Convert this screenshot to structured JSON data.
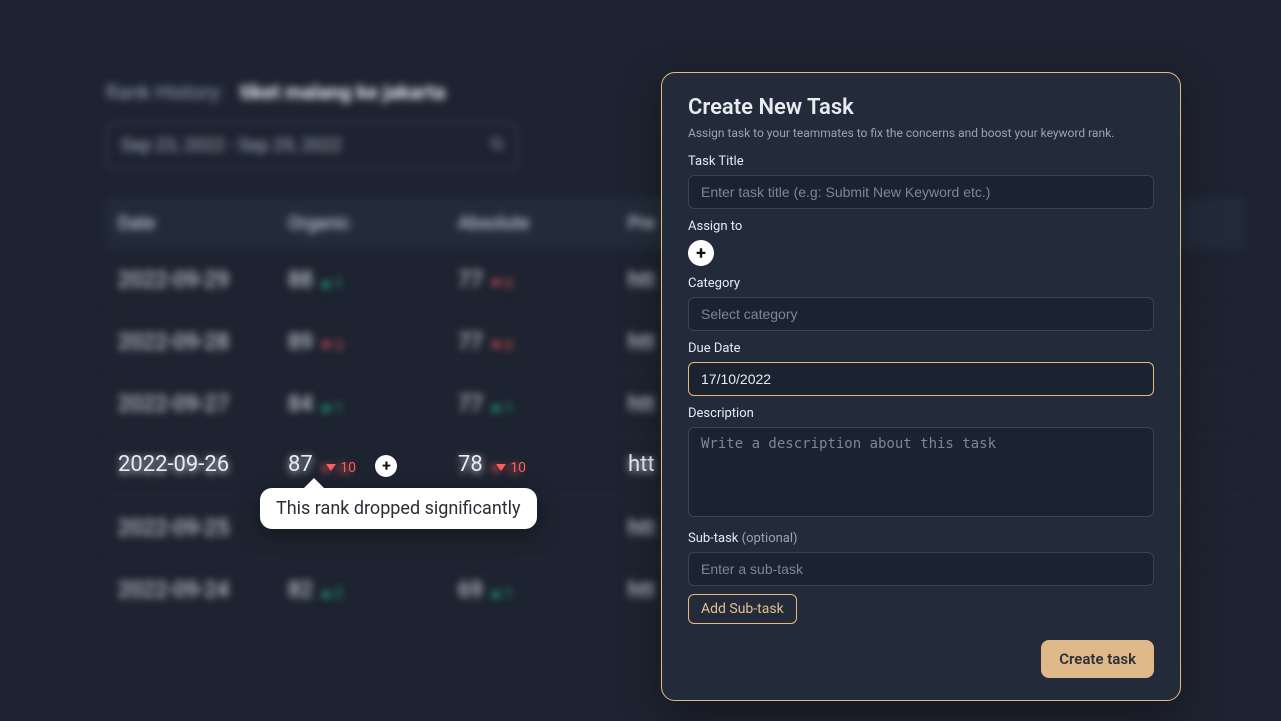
{
  "page": {
    "header_label": "Rank History:",
    "keyword": "tiket malang ke jakarta",
    "date_range_placeholder": "Sep 23, 2022 - Sep 29, 2022"
  },
  "table": {
    "columns": {
      "c1": "Date",
      "c2": "Organic",
      "c3": "Absolute",
      "c4": "Pre"
    },
    "rows": [
      {
        "date": "2022-09-29",
        "organic": 88,
        "org_dir": "up",
        "org_delta": 1,
        "absolute": 77,
        "abs_dir": "down",
        "abs_delta": 0,
        "target": "htt"
      },
      {
        "date": "2022-09-28",
        "organic": 89,
        "org_dir": "down",
        "org_delta": 3,
        "absolute": 77,
        "abs_dir": "down",
        "abs_delta": 0,
        "target": "htt"
      },
      {
        "date": "2022-09-27",
        "organic": 84,
        "org_dir": "up",
        "org_delta": 1,
        "absolute": 77,
        "abs_dir": "up",
        "abs_delta": 1,
        "target": "htt"
      },
      {
        "date": "2022-09-26",
        "organic": 87,
        "org_dir": "down",
        "org_delta": 10,
        "absolute": 78,
        "abs_dir": "down",
        "abs_delta": 10,
        "target": "htt"
      },
      {
        "date": "2022-09-25",
        "organic": null,
        "org_dir": null,
        "org_delta": null,
        "absolute": null,
        "abs_dir": null,
        "abs_delta": null,
        "target": "htt"
      },
      {
        "date": "2022-09-24",
        "organic": 82,
        "org_dir": "up",
        "org_delta": 2,
        "absolute": 69,
        "abs_dir": "up",
        "abs_delta": 1,
        "target": "htt"
      }
    ],
    "highlighted_index": 3,
    "tooltip": "This rank dropped significantly"
  },
  "panel": {
    "title": "Create New Task",
    "subtitle": "Assign task to your teammates to fix the concerns and boost your keyword rank.",
    "labels": {
      "task_title": "Task Title",
      "assign_to": "Assign to",
      "category": "Category",
      "due_date": "Due Date",
      "description": "Description",
      "sub_task": "Sub-task",
      "optional": "(optional)"
    },
    "placeholders": {
      "task_title": "Enter task title (e.g: Submit New Keyword etc.)",
      "category": "Select category",
      "description": "Write a description about this task",
      "sub_task": "Enter a sub-task"
    },
    "values": {
      "due_date": "17/10/2022"
    },
    "buttons": {
      "add_sub_task": "Add Sub-task",
      "create_task": "Create task"
    }
  }
}
